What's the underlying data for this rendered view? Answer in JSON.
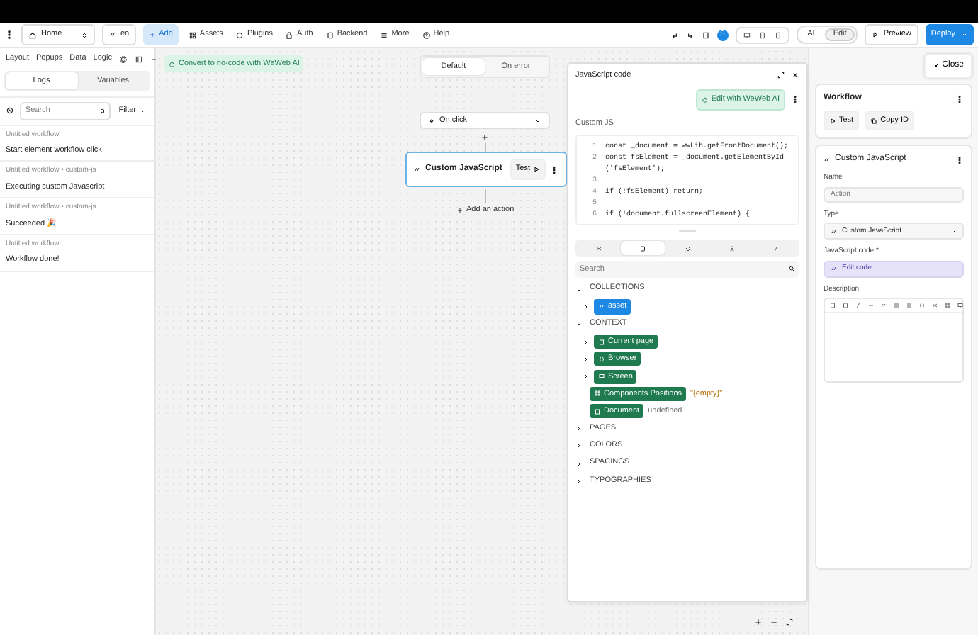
{
  "toolbar": {
    "page_select": "Home",
    "language": "en",
    "add_button": "Add",
    "nav_items": [
      "Assets",
      "Plugins",
      "Auth",
      "Backend",
      "More",
      "Help"
    ],
    "avatar": "S",
    "modes": [
      {
        "label": "AI",
        "selected": false
      },
      {
        "label": "Edit",
        "selected": true
      }
    ],
    "preview_button": "Preview",
    "deploy_button": "Deploy"
  },
  "left_panel": {
    "tabs": [
      "Layout",
      "Popups",
      "Data",
      "Logic"
    ],
    "subtabs": [
      {
        "label": "Logs",
        "selected": true
      },
      {
        "label": "Variables",
        "selected": false
      }
    ],
    "search": {
      "placeholder": "Search"
    },
    "filter": "Filter",
    "logs": [
      {
        "source": "Untitled workflow",
        "message": "Start element workflow  click"
      },
      {
        "source": "Untitled workflow • custom-js",
        "message": "Executing custom Javascript"
      },
      {
        "source": "Untitled workflow • custom-js",
        "message": "Succeeded 🎉"
      },
      {
        "source": "Untitled workflow",
        "message": "Workflow done!"
      }
    ]
  },
  "canvas": {
    "convert_button": "Convert to no-code with WeWeb AI",
    "branches": [
      {
        "label": "Default",
        "selected": true
      },
      {
        "label": "On error",
        "selected": false
      }
    ],
    "trigger": "On click",
    "action": {
      "title": "Custom JavaScript",
      "test": "Test"
    },
    "add_action": "Add an action"
  },
  "code_panel": {
    "title": "JavaScript code",
    "ai_button": "Edit with WeWeb AI",
    "label": "Custom JS",
    "code_lines": [
      {
        "number": "1",
        "text": "const _document = wwLib.getFrontDocument();"
      },
      {
        "number": "2",
        "text": "const fsElement = _document.getElementById"
      },
      {
        "text": "('fsElement');"
      },
      {
        "number": "3"
      },
      {
        "number": "4",
        "text": "if (!fsElement) return;"
      },
      {
        "number": "5"
      },
      {
        "number": "6",
        "text": "if (!document.fullscreenElement) {"
      }
    ],
    "icon_tabs": [
      {
        "selected": false
      },
      {
        "selected": true
      },
      {
        "selected": false
      },
      {
        "selected": false
      },
      {
        "selected": false
      }
    ],
    "search": {
      "placeholder": "Search"
    },
    "tree": [
      {
        "label": "COLLECTIONS",
        "expanded": true,
        "children": [
          {
            "label": "asset",
            "color": "#1e88e5",
            "expandable": true
          }
        ]
      },
      {
        "label": "CONTEXT",
        "expanded": true,
        "children": [
          {
            "label": "Current page",
            "color": "#1f7a50",
            "expandable": true
          },
          {
            "label": "Browser",
            "color": "#1f7a50",
            "expandable": true
          },
          {
            "label": "Screen",
            "color": "#1f7a50",
            "expandable": true
          },
          {
            "label": "Components Positions",
            "color": "#1f7a50",
            "expandable": false,
            "value": "\"{empty}\"",
            "kind": "string"
          },
          {
            "label": "Document",
            "color": "#1f7a50",
            "expandable": false,
            "value": "undefined",
            "kind": "undefined"
          }
        ]
      },
      {
        "label": "PAGES",
        "expanded": false
      },
      {
        "label": "COLORS",
        "expanded": false
      },
      {
        "label": "SPACINGS",
        "expanded": false
      },
      {
        "label": "TYPOGRAPHIES",
        "expanded": false
      }
    ]
  },
  "right_panel": {
    "close_button": "Close",
    "workflow": {
      "title": "Workflow",
      "buttons": [
        "Test",
        "Copy ID"
      ]
    },
    "action": {
      "title": "Custom JavaScript",
      "name_label": "Name",
      "name_placeholder": "Action",
      "type_label": "Type",
      "type_value": "Custom JavaScript",
      "code_label": "JavaScript code *",
      "code_button": "Edit code",
      "description_label": "Description"
    }
  }
}
